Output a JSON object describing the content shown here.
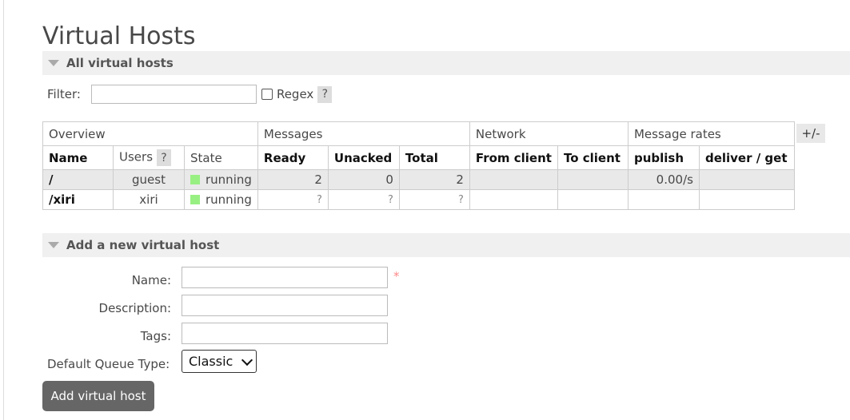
{
  "page": {
    "title": "Virtual Hosts"
  },
  "all_vhosts": {
    "heading": "All virtual hosts",
    "filter_label": "Filter:",
    "filter_value": "",
    "regex_label": "Regex",
    "help_glyph": "?",
    "table": {
      "groups": [
        "Overview",
        "Messages",
        "Network",
        "Message rates"
      ],
      "columns": [
        "Name",
        "Users",
        "State",
        "Ready",
        "Unacked",
        "Total",
        "From client",
        "To client",
        "publish",
        "deliver / get"
      ],
      "rows": [
        {
          "name": "/",
          "users": "guest",
          "state": "running",
          "ready": "2",
          "unacked": "0",
          "total": "2",
          "from_client": "",
          "to_client": "",
          "publish": "0.00/s",
          "deliver_get": ""
        },
        {
          "name": "/xiri",
          "users": "xiri",
          "state": "running",
          "ready": "?",
          "unacked": "?",
          "total": "?",
          "from_client": "",
          "to_client": "",
          "publish": "",
          "deliver_get": ""
        }
      ],
      "plus_minus": "+/-"
    }
  },
  "add_vhost": {
    "heading": "Add a new virtual host",
    "name_label": "Name:",
    "description_label": "Description:",
    "tags_label": "Tags:",
    "queue_type_label": "Default Queue Type:",
    "queue_type_value": "Classic",
    "required_mark": "*",
    "submit_label": "Add virtual host"
  },
  "colors": {
    "running_dot": "#98f082",
    "button_bg": "#666666",
    "section_bg": "#f0f0f0"
  }
}
